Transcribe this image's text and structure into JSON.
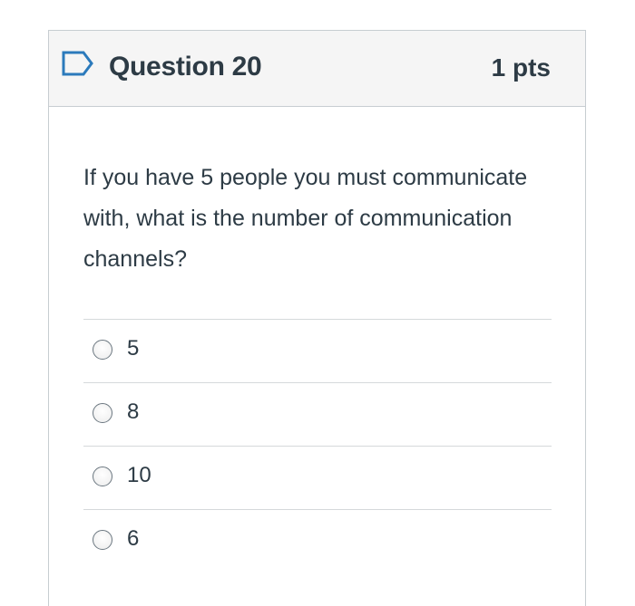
{
  "question": {
    "title": "Question 20",
    "points": "1 pts",
    "text": "If you have 5 people you must communicate with, what is the number of communication channels?",
    "flag_icon": "flag-outline-icon",
    "accent_color": "#2b7abc"
  },
  "answers": [
    {
      "label": "5",
      "selected": false
    },
    {
      "label": "8",
      "selected": false
    },
    {
      "label": "10",
      "selected": false
    },
    {
      "label": "6",
      "selected": false
    }
  ]
}
